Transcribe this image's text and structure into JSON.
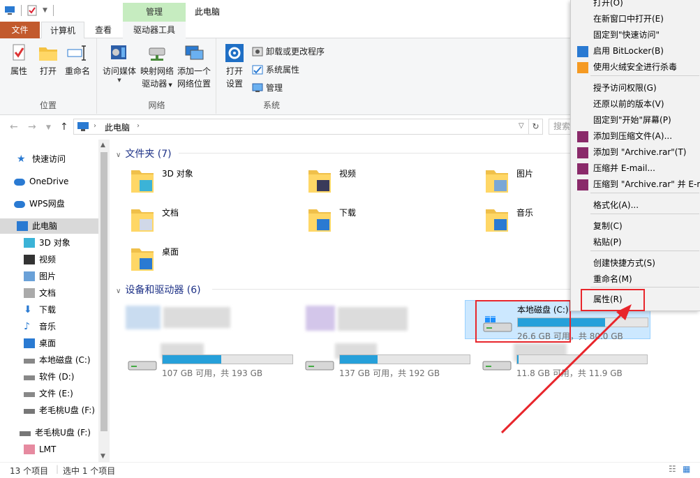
{
  "titlebar": {
    "title": "此电脑",
    "context_tab": "管理"
  },
  "tabs": {
    "file": "文件",
    "computer": "计算机",
    "view": "查看",
    "drive_tools": "驱动器工具"
  },
  "ribbon": {
    "location": {
      "label": "位置",
      "properties": "属性",
      "open": "打开",
      "rename": "重命名"
    },
    "network": {
      "label": "网络",
      "access_media": "访问媒体",
      "map_drive_1": "映射网络",
      "map_drive_2": "驱动器",
      "add_location_1": "添加一个",
      "add_location_2": "网络位置"
    },
    "system": {
      "label": "系统",
      "open_settings_1": "打开",
      "open_settings_2": "设置",
      "uninstall": "卸载或更改程序",
      "system_properties": "系统属性",
      "manage": "管理"
    }
  },
  "address": {
    "crumb": "此电脑",
    "search_placeholder": "搜索"
  },
  "sidebar": {
    "items": [
      {
        "label": "快速访问",
        "icon": "star-icon"
      },
      {
        "label": "OneDrive",
        "icon": "cloud-icon"
      },
      {
        "label": "WPS网盘",
        "icon": "cloud-icon"
      },
      {
        "label": "此电脑",
        "icon": "computer-icon"
      },
      {
        "label": "3D 对象",
        "icon": "cube-icon"
      },
      {
        "label": "视频",
        "icon": "video-icon"
      },
      {
        "label": "图片",
        "icon": "picture-icon"
      },
      {
        "label": "文档",
        "icon": "document-icon"
      },
      {
        "label": "下载",
        "icon": "download-icon"
      },
      {
        "label": "音乐",
        "icon": "music-icon"
      },
      {
        "label": "桌面",
        "icon": "desktop-icon"
      },
      {
        "label": "本地磁盘 (C:)",
        "icon": "drive-icon"
      },
      {
        "label": "软件 (D:)",
        "icon": "drive-icon"
      },
      {
        "label": "文件 (E:)",
        "icon": "drive-icon"
      },
      {
        "label": "老毛桃U盘 (F:)",
        "icon": "usb-drive-icon"
      },
      {
        "label": "老毛桃U盘 (F:)",
        "icon": "usb-drive-icon"
      },
      {
        "label": "LMT",
        "icon": "user-icon"
      }
    ]
  },
  "content": {
    "folders_header": "文件夹 (7)",
    "devices_header": "设备和驱动器 (6)",
    "folders": [
      {
        "label": "3D 对象"
      },
      {
        "label": "视频"
      },
      {
        "label": "图片"
      },
      {
        "label": "文档"
      },
      {
        "label": "下载"
      },
      {
        "label": "音乐"
      },
      {
        "label": "桌面"
      }
    ],
    "drives": [
      {
        "name": "本地磁盘 (C:)",
        "space": "26.6 GB 可用，共 80.0 GB",
        "used_fraction": 0.67
      },
      {
        "name": "",
        "space": "107 GB 可用，共 193 GB",
        "used_fraction": 0.45
      },
      {
        "name": "",
        "space": "137 GB 可用，共 192 GB",
        "used_fraction": 0.29
      },
      {
        "name": "",
        "space": "11.8 GB 可用，共 11.9 GB",
        "used_fraction": 0.01
      }
    ]
  },
  "status": {
    "count": "13 个项目",
    "selected": "选中 1 个项目"
  },
  "context_menu": {
    "items": [
      "打开(O)",
      "在新窗口中打开(E)",
      "固定到\"快速访问\"",
      "启用 BitLocker(B)",
      "使用火绒安全进行杀毒",
      "授予访问权限(G)",
      "还原以前的版本(V)",
      "固定到\"开始\"屏幕(P)",
      "添加到压缩文件(A)...",
      "添加到 \"Archive.rar\"(T)",
      "压缩并 E-mail...",
      "压缩到 \"Archive.rar\" 并 E-mail",
      "格式化(A)...",
      "复制(C)",
      "粘贴(P)",
      "创建快捷方式(S)",
      "重命名(M)",
      "属性(R)"
    ]
  },
  "colors": {
    "file_tab": "#c25a2d",
    "context_tab": "#c6ecc0",
    "highlight": "#e8262c",
    "progress": "#26a0da",
    "header_text": "#1e3287"
  }
}
